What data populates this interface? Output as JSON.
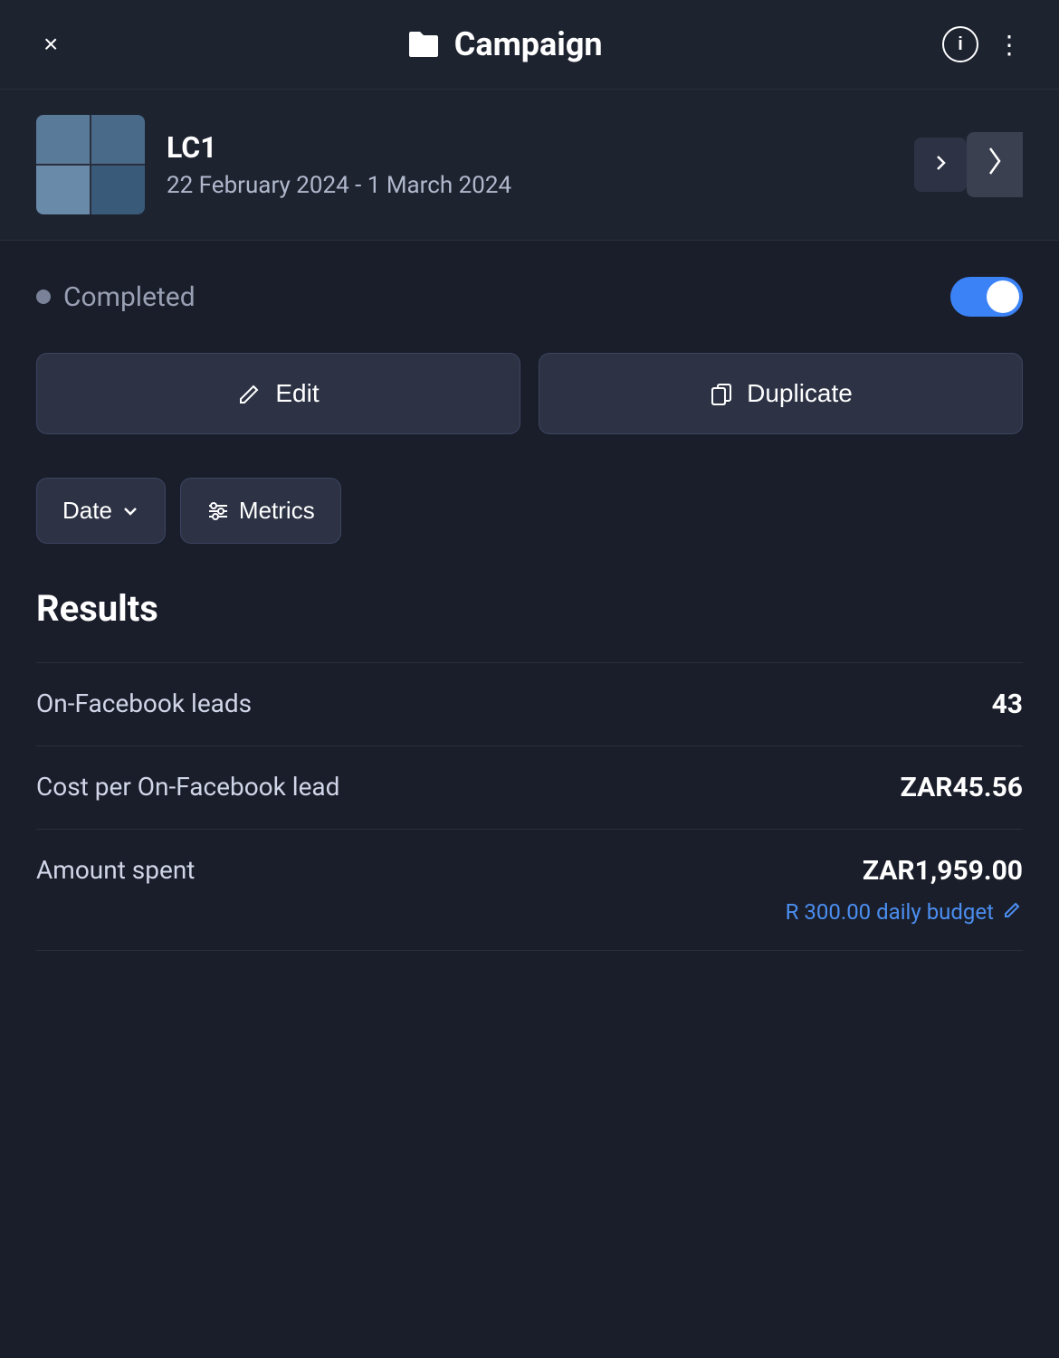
{
  "header": {
    "title": "Campaign",
    "close_label": "×",
    "info_label": "i",
    "more_label": "⋮"
  },
  "campaign": {
    "name": "LC1",
    "dates": "22 February 2024 - 1 March 2024"
  },
  "status": {
    "label": "Completed",
    "toggle_on": true
  },
  "buttons": {
    "edit_label": "Edit",
    "duplicate_label": "Duplicate",
    "date_label": "Date",
    "metrics_label": "Metrics"
  },
  "results": {
    "title": "Results",
    "rows": [
      {
        "label": "On-Facebook leads",
        "value": "43"
      },
      {
        "label": "Cost per On-Facebook lead",
        "value": "ZAR45.56"
      },
      {
        "label": "Amount spent",
        "value": "ZAR1,959.00"
      }
    ],
    "budget_note": "R 300.00 daily budget"
  }
}
